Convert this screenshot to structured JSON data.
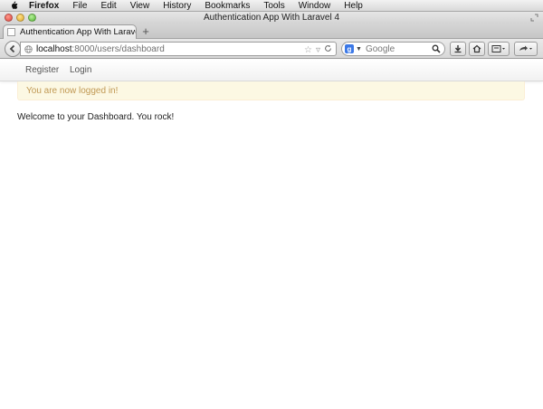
{
  "menubar": {
    "apple_icon": "apple-logo-icon",
    "items": [
      "Firefox",
      "File",
      "Edit",
      "View",
      "History",
      "Bookmarks",
      "Tools",
      "Window",
      "Help"
    ]
  },
  "window": {
    "title": "Authentication App With Laravel 4"
  },
  "tabs": [
    {
      "label": "Authentication App With Larave..."
    }
  ],
  "newtab_label": "+",
  "urlbar": {
    "host": "localhost",
    "path": ":8000/users/dashboard"
  },
  "search": {
    "engine_icon": "google-icon",
    "engine_letter": "g",
    "placeholder": "Google"
  },
  "site_nav": {
    "register": "Register",
    "login": "Login"
  },
  "alert": {
    "text": "You are now logged in!",
    "bg_color": "#fcf8e3",
    "text_color": "#c09853"
  },
  "page": {
    "welcome": "Welcome to your Dashboard. You rock!"
  }
}
